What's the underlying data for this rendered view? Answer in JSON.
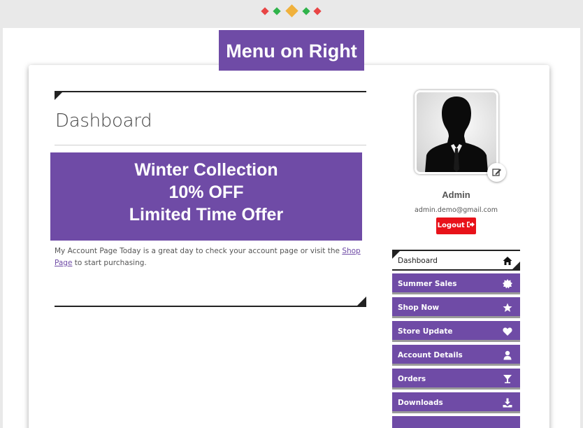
{
  "header": {
    "ribbon_title": "Menu on Right",
    "diamond_colors": [
      "#e84545",
      "#2fb34a",
      "#f0b13c",
      "#2fb34a",
      "#e84545"
    ]
  },
  "main": {
    "title": "Dashboard",
    "banner": {
      "line1": "Winter Collection",
      "line2": "10% OFF",
      "line3": "Limited Time Offer"
    },
    "intro_prefix": "My Account Page Today is a great day to check your account page or visit the ",
    "intro_link": "Shop Page",
    "intro_suffix": " to start purchasing."
  },
  "user": {
    "name": "Admin",
    "email": "admin.demo@gmail.com",
    "logout_label": "Logout",
    "logout_icon": "sign-out-icon",
    "edit_icon": "edit-icon"
  },
  "menu": [
    {
      "label": "Dashboard",
      "icon": "home-icon"
    },
    {
      "label": "Summer Sales",
      "icon": "badge-icon"
    },
    {
      "label": "Shop Now",
      "icon": "star-icon"
    },
    {
      "label": "Store Update",
      "icon": "heart-icon"
    },
    {
      "label": "Account Details",
      "icon": "user-icon"
    },
    {
      "label": "Orders",
      "icon": "cocktail-icon"
    },
    {
      "label": "Downloads",
      "icon": "download-icon"
    }
  ],
  "colors": {
    "accent": "#6f4ba6",
    "logout": "#e8121a",
    "text": "#555555"
  }
}
